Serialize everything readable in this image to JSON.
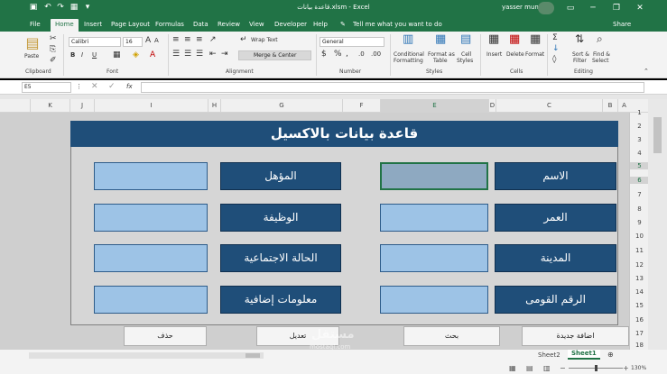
{
  "window": {
    "title": "قاعدة بيانات.xlsm - Excel",
    "user": "yasser munir"
  },
  "ribbon_tabs": [
    "File",
    "Home",
    "Insert",
    "Page Layout",
    "Formulas",
    "Data",
    "Review",
    "View",
    "Developer",
    "Help"
  ],
  "active_tab": "Home",
  "tell_me": "Tell me what you want to do",
  "share_label": "Share",
  "ribbon": {
    "clipboard": {
      "label": "Clipboard",
      "paste": "Paste"
    },
    "font": {
      "label": "Font",
      "name": "Calibri",
      "size": "16",
      "bold": "B",
      "italic": "I",
      "underline": "U"
    },
    "alignment": {
      "label": "Alignment",
      "wrap": "Wrap Text",
      "merge": "Merge & Center"
    },
    "number": {
      "label": "Number",
      "format": "General",
      "currency": "$",
      "percent": "%",
      "comma": ","
    },
    "styles": {
      "label": "Styles",
      "conditional_1": "Conditional",
      "conditional_2": "Formatting",
      "table_1": "Format as",
      "table_2": "Table",
      "cell_1": "Cell",
      "cell_2": "Styles"
    },
    "cells": {
      "label": "Cells",
      "insert": "Insert",
      "delete": "Delete",
      "format": "Format"
    },
    "editing": {
      "label": "Editing",
      "sort_1": "Sort &",
      "sort_2": "Filter",
      "find_1": "Find &",
      "find_2": "Select"
    }
  },
  "formula_bar": {
    "name_box": "E5",
    "fx": "fx",
    "value": ""
  },
  "columns": [
    "K",
    "J",
    "I",
    "H",
    "G",
    "F",
    "E",
    "D",
    "C",
    "B",
    "A"
  ],
  "rows": [
    "1",
    "2",
    "3",
    "4",
    "5",
    "6",
    "7",
    "8",
    "9",
    "10",
    "11",
    "12",
    "13",
    "14",
    "15",
    "16",
    "17",
    "18"
  ],
  "form": {
    "title": "قاعدة بيانات بالاكسيل",
    "right_labels": [
      "الاسم",
      "العمر",
      "المدينة",
      "الرقم القومى"
    ],
    "left_labels": [
      "المؤهل",
      "الوظيفة",
      "الحالة الاجتماعية",
      "معلومات إضافية"
    ]
  },
  "buttons": {
    "delete": "حذف",
    "edit": "تعديل",
    "search": "بحث",
    "add": "اضافة جديدة"
  },
  "sheets": [
    "Sheet2",
    "Sheet1"
  ],
  "active_sheet": "Sheet1",
  "zoom": "130%",
  "watermark": {
    "arabic": "مستقل",
    "latin": "mostaql.com"
  },
  "colors": {
    "excel_green": "#217346",
    "label_blue": "#1f4e79",
    "input_blue": "#9dc3e6"
  }
}
